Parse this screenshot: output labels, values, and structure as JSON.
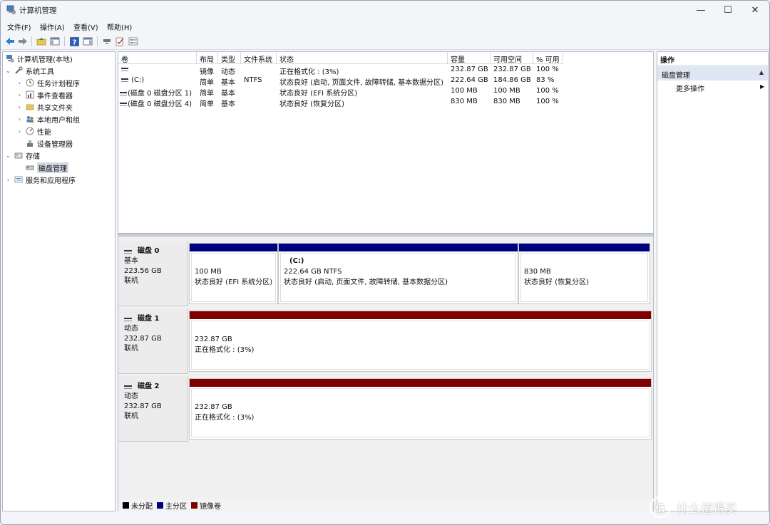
{
  "window": {
    "title": "计算机管理",
    "controls": {
      "minimize": "—",
      "maximize": "☐",
      "close": "✕"
    }
  },
  "menu": [
    "文件(F)",
    "操作(A)",
    "查看(V)",
    "帮助(H)"
  ],
  "tree": {
    "root": "计算机管理(本地)",
    "system_tools": "系统工具",
    "items": [
      "任务计划程序",
      "事件查看器",
      "共享文件夹",
      "本地用户和组",
      "性能",
      "设备管理器"
    ],
    "storage": "存储",
    "disk_mgmt": "磁盘管理",
    "services": "服务和应用程序"
  },
  "volumes": {
    "headers": [
      "卷",
      "布局",
      "类型",
      "文件系统",
      "状态",
      "容量",
      "可用空间",
      "% 可用"
    ],
    "rows": [
      {
        "vol": "",
        "layout": "镜像",
        "type": "动态",
        "fs": "",
        "status": "正在格式化 : (3%)",
        "cap": "232.87 GB",
        "free": "232.87 GB",
        "pct": "100 %"
      },
      {
        "vol": "(C:)",
        "layout": "简单",
        "type": "基本",
        "fs": "NTFS",
        "status": "状态良好 (启动, 页面文件, 故障转储, 基本数据分区)",
        "cap": "222.64 GB",
        "free": "184.86 GB",
        "pct": "83 %"
      },
      {
        "vol": "(磁盘 0 磁盘分区 1)",
        "layout": "简单",
        "type": "基本",
        "fs": "",
        "status": "状态良好 (EFI 系统分区)",
        "cap": "100 MB",
        "free": "100 MB",
        "pct": "100 %"
      },
      {
        "vol": "(磁盘 0 磁盘分区 4)",
        "layout": "简单",
        "type": "基本",
        "fs": "",
        "status": "状态良好 (恢复分区)",
        "cap": "830 MB",
        "free": "830 MB",
        "pct": "100 %"
      }
    ]
  },
  "disks": [
    {
      "name": "磁盘 0",
      "kind": "基本",
      "size": "223.56 GB",
      "state": "联机",
      "parts": [
        {
          "title": "",
          "line1": "100 MB",
          "line2": "状态良好 (EFI 系统分区)",
          "color": "#00007f"
        },
        {
          "title": "(C:)",
          "line1": "222.64 GB NTFS",
          "line2": "状态良好 (启动, 页面文件, 故障转储, 基本数据分区)",
          "color": "#00007f"
        },
        {
          "title": "",
          "line1": "830 MB",
          "line2": "状态良好 (恢复分区)",
          "color": "#00007f"
        }
      ]
    },
    {
      "name": "磁盘 1",
      "kind": "动态",
      "size": "232.87 GB",
      "state": "联机",
      "parts": [
        {
          "title": "",
          "line1": "232.87 GB",
          "line2": "正在格式化 : (3%)",
          "color": "#7f0000"
        }
      ]
    },
    {
      "name": "磁盘 2",
      "kind": "动态",
      "size": "232.87 GB",
      "state": "联机",
      "parts": [
        {
          "title": "",
          "line1": "232.87 GB",
          "line2": "正在格式化 : (3%)",
          "color": "#7f0000"
        }
      ]
    }
  ],
  "legend": [
    {
      "label": "未分配",
      "color": "#000000"
    },
    {
      "label": "主分区",
      "color": "#00007f"
    },
    {
      "label": "镜像卷",
      "color": "#7f0000"
    }
  ],
  "actions": {
    "header": "操作",
    "section": "磁盘管理",
    "more": "更多操作"
  },
  "watermark": {
    "logo": "值",
    "text": "什么值得买"
  }
}
